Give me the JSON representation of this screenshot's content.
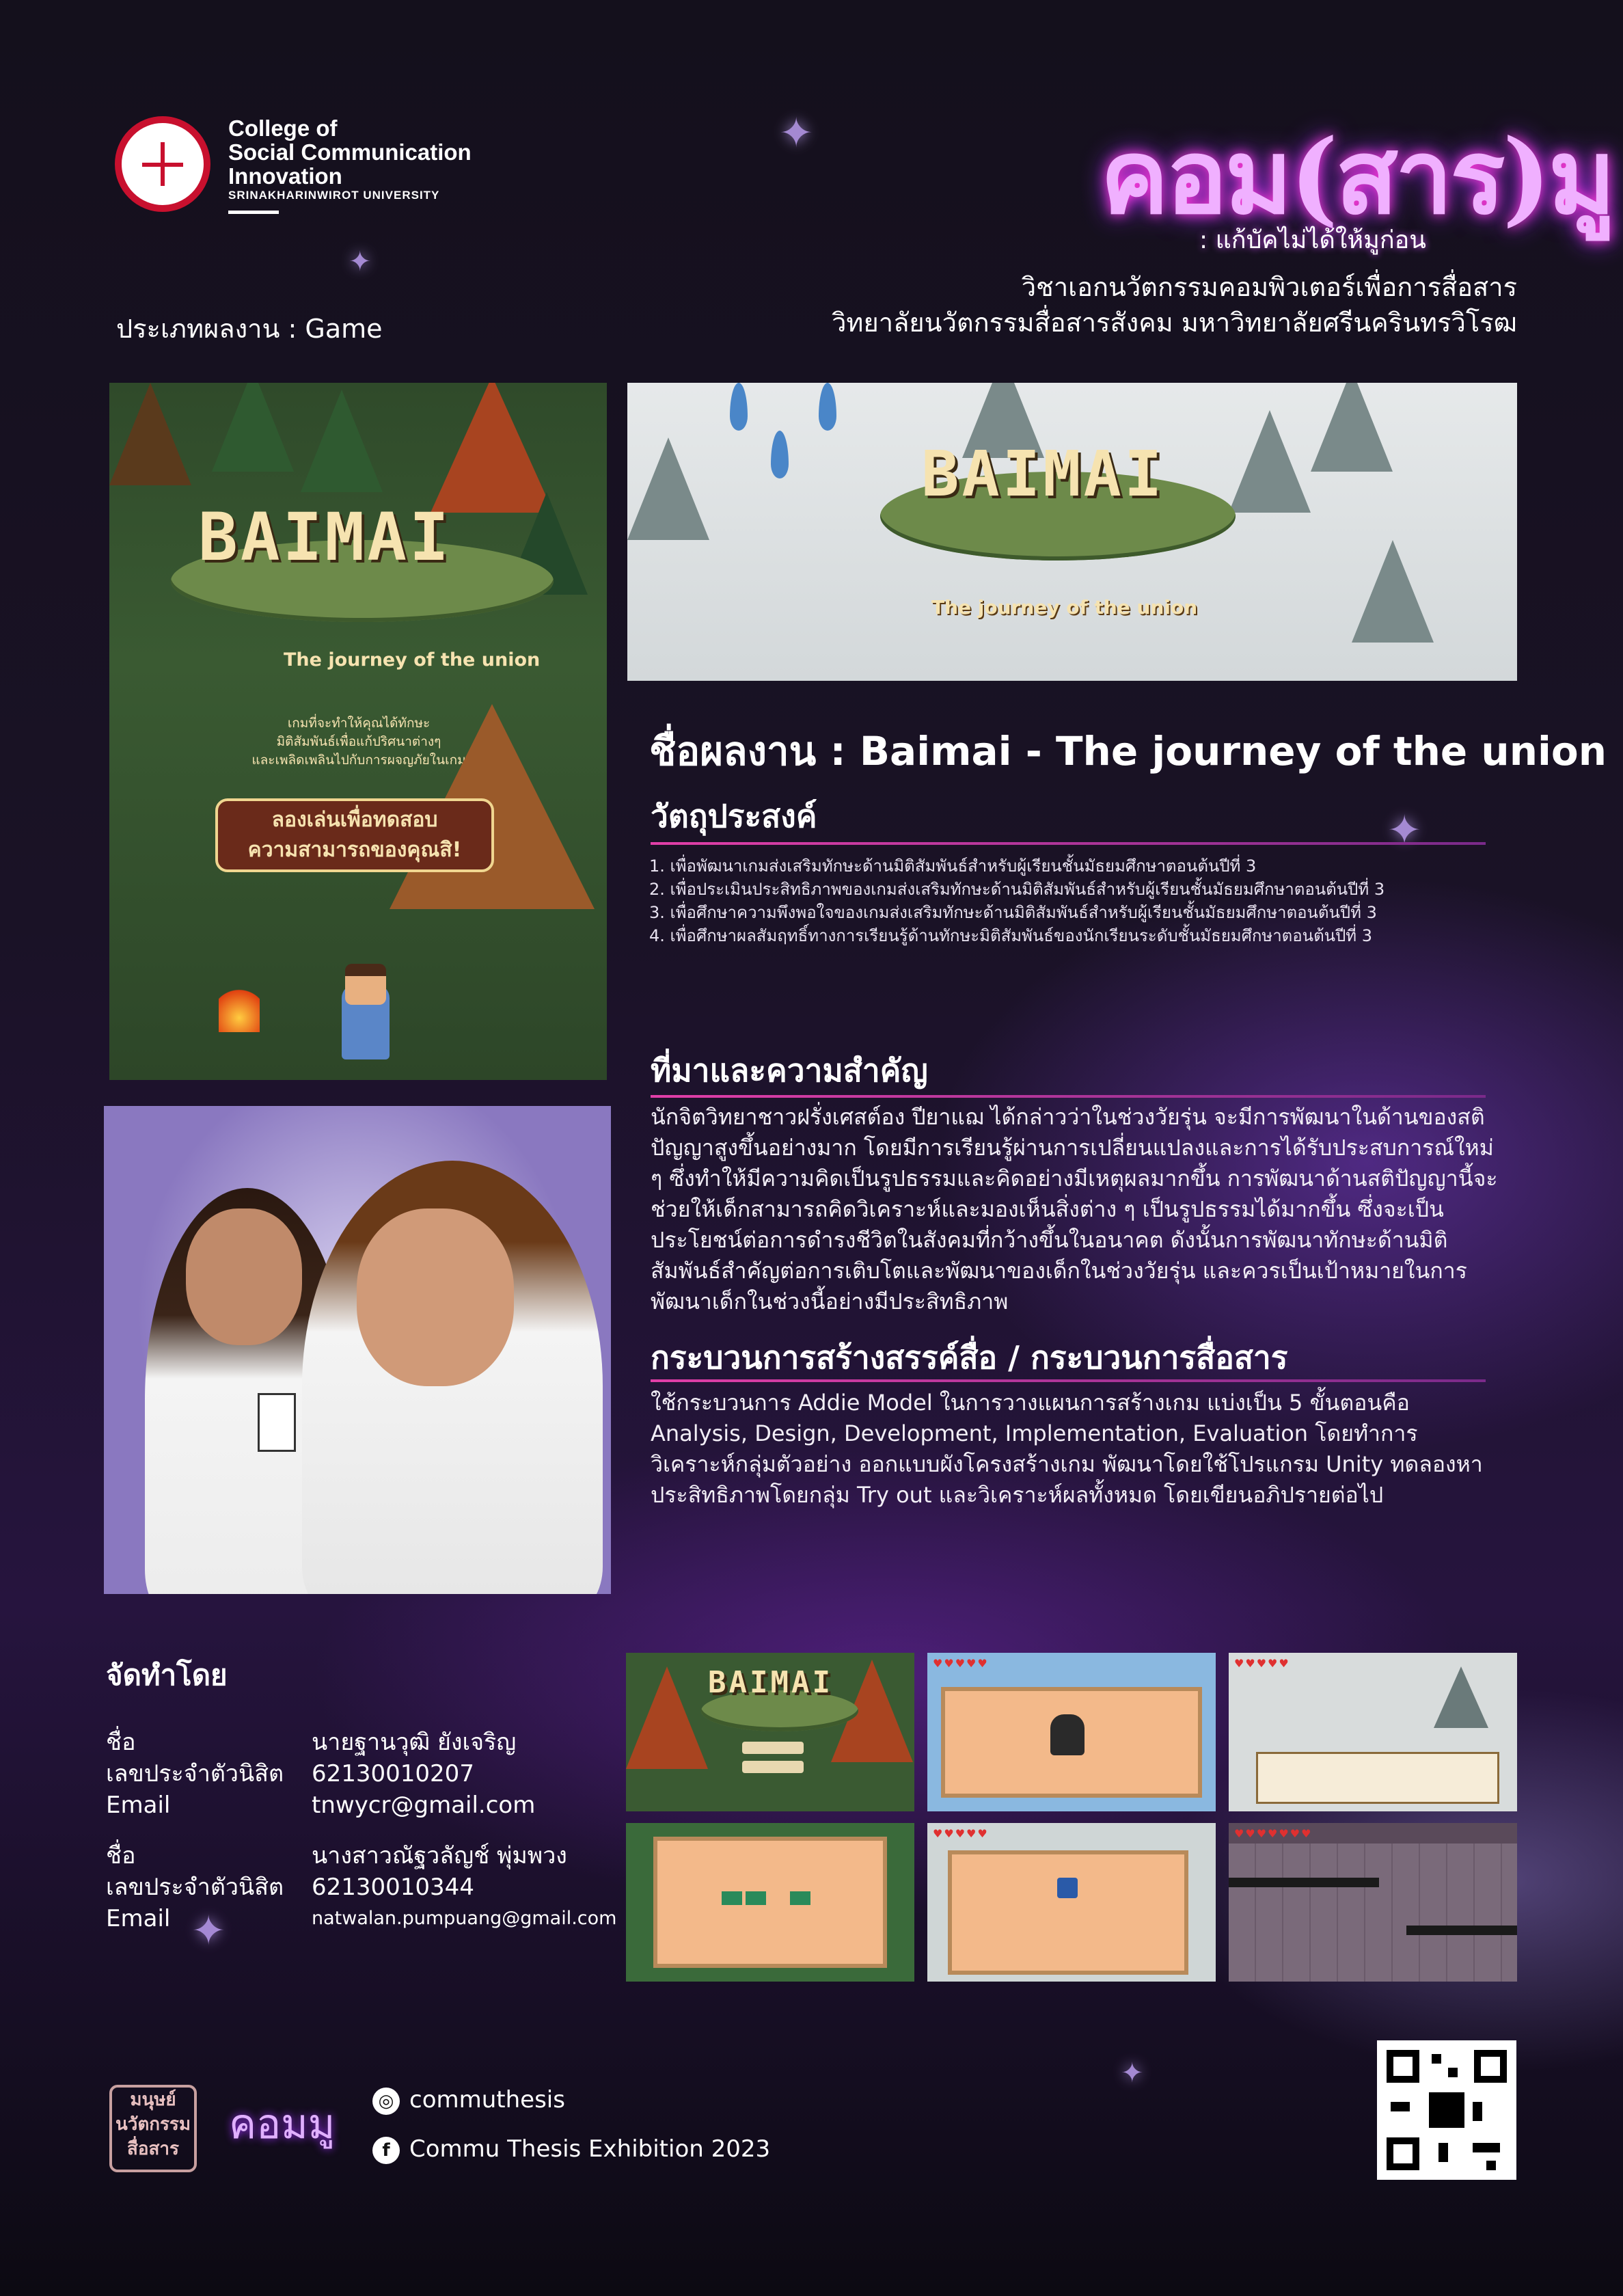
{
  "header": {
    "college_name_lines": [
      "College of",
      "Social Communication",
      "Innovation"
    ],
    "university": "SRINAKHARINWIROT UNIVERSITY",
    "project_logo": "คอม(สาร)มู",
    "project_logo_sub": ": แก้บัคไม่ได้ให้มูก่อน",
    "department_line1": "วิชาเอกนวัตกรรมคอมพิวเตอร์เพื่อการสื่อสาร",
    "department_line2": "วิทยาลัยนวัตกรรมสื่อสารสังคม มหาวิทยาลัยศรีนครินทรวิโรฒ",
    "work_type": "ประเภทผลงาน : Game"
  },
  "poster": {
    "title": "BAIMAI",
    "subtitle": "The journey of the union",
    "description_lines": [
      "เกมที่จะทำให้คุณได้ทักษะ",
      "มิติสัมพันธ์เพื่อแก้ปริศนาต่างๆ",
      "และเพลิดเพลินไปกับการผจญภัยในเกม"
    ],
    "cta_lines": [
      "ลองเล่นเพื่อทดสอบ",
      "ความสามารถของคุณสิ!"
    ]
  },
  "banner": {
    "title": "BAIMAI",
    "subtitle": "The journey of the union"
  },
  "work_name": "ชื่อผลงาน : Baimai - The journey of the union",
  "objectives": {
    "heading": "วัตถุประสงค์",
    "items": [
      "1. เพื่อพัฒนาเกมส่งเสริมทักษะด้านมิติสัมพันธ์สำหรับผู้เรียนชั้นมัธยมศึกษาตอนต้นปีที่ 3",
      "2. เพื่อประเมินประสิทธิภาพของเกมส่งเสริมทักษะด้านมิติสัมพันธ์สำหรับผู้เรียนชั้นมัธยมศึกษาตอนต้นปีที่ 3",
      "3. เพื่อศึกษาความพึงพอใจของเกมส่งเสริมทักษะด้านมิติสัมพันธ์สำหรับผู้เรียนชั้นมัธยมศึกษาตอนต้นปีที่ 3",
      "4. เพื่อศึกษาผลสัมฤทธิ์ทางการเรียนรู้ด้านทักษะมิติสัมพันธ์ของนักเรียนระดับชั้นมัธยมศึกษาตอนต้นปีที่ 3"
    ]
  },
  "background": {
    "heading": "ที่มาและความสำคัญ",
    "text": "นักจิตวิทยาชาวฝรั่งเศสต์อง ปียาแฌ ได้กล่าวว่าในช่วงวัยรุ่น จะมีการพัฒนาในด้านของสติปัญญาสูงขึ้นอย่างมาก โดยมีการเรียนรู้ผ่านการเปลี่ยนแปลงและการได้รับประสบการณ์ใหม่ ๆ ซึ่งทำให้มีความคิดเป็นรูปธรรมและคิดอย่างมีเหตุผลมากขึ้น การพัฒนาด้านสติปัญญานี้จะช่วยให้เด็กสามารถคิดวิเคราะห์และมองเห็นสิ่งต่าง ๆ เป็นรูปธรรมได้มากขึ้น ซึ่งจะเป็นประโยชน์ต่อการดำรงชีวิตในสังคมที่กว้างขึ้นในอนาคต ดังนั้นการพัฒนาทักษะด้านมิติสัมพันธ์สำคัญต่อการเติบโตและพัฒนาของเด็กในช่วงวัยรุ่น และควรเป็นเป้าหมายในการพัฒนาเด็กในช่วงนี้อย่างมีประสิทธิภาพ"
  },
  "process": {
    "heading": "กระบวนการสร้างสรรค์สื่อ / กระบวนการสื่อสาร",
    "text": "ใช้กระบวนการ Addie Model ในการวางแผนการสร้างเกม แบ่งเป็น 5 ขั้นตอนคือ Analysis, Design, Development, Implementation, Evaluation โดยทำการวิเคราะห์กลุ่มตัวอย่าง ออกแบบผังโครงสร้างเกม พัฒนาโดยใช้โปรแกรม Unity ทดลองหาประสิทธิภาพโดยกลุ่ม Try out และวิเคราะห์ผลทั้งหมด โดยเขียนอภิปรายต่อไป"
  },
  "made_by": {
    "heading": "จัดทำโดย",
    "members": [
      {
        "name_label": "ชื่อ",
        "name": "นายฐานวุฒิ ยังเจริญ",
        "id_label": "เลขประจำตัวนิสิต",
        "id": "62130010207",
        "email_label": "Email",
        "email": "tnwycr@gmail.com"
      },
      {
        "name_label": "ชื่อ",
        "name": "นางสาวณัฐวลัญช์ พุ่มพวง",
        "id_label": "เลขประจำตัวนิสิต",
        "id": "62130010344",
        "email_label": "Email",
        "email": "natwalan.pumpuang@gmail.com"
      }
    ]
  },
  "screenshots": {
    "thumb1_title": "BAIMAI"
  },
  "footer": {
    "instagram": "commuthesis",
    "facebook": "Commu Thesis Exhibition 2023",
    "left_logo_text": "มนุษย์ นวัตกรรม สื่อสาร",
    "small_logo_text": "คอมมู"
  },
  "colors": {
    "accent_pink": "#e23fa8",
    "accent_purple": "#7a2a8a",
    "logo_red": "#c8102e"
  },
  "icons": [
    "instagram-icon",
    "facebook-icon",
    "qr-code"
  ]
}
